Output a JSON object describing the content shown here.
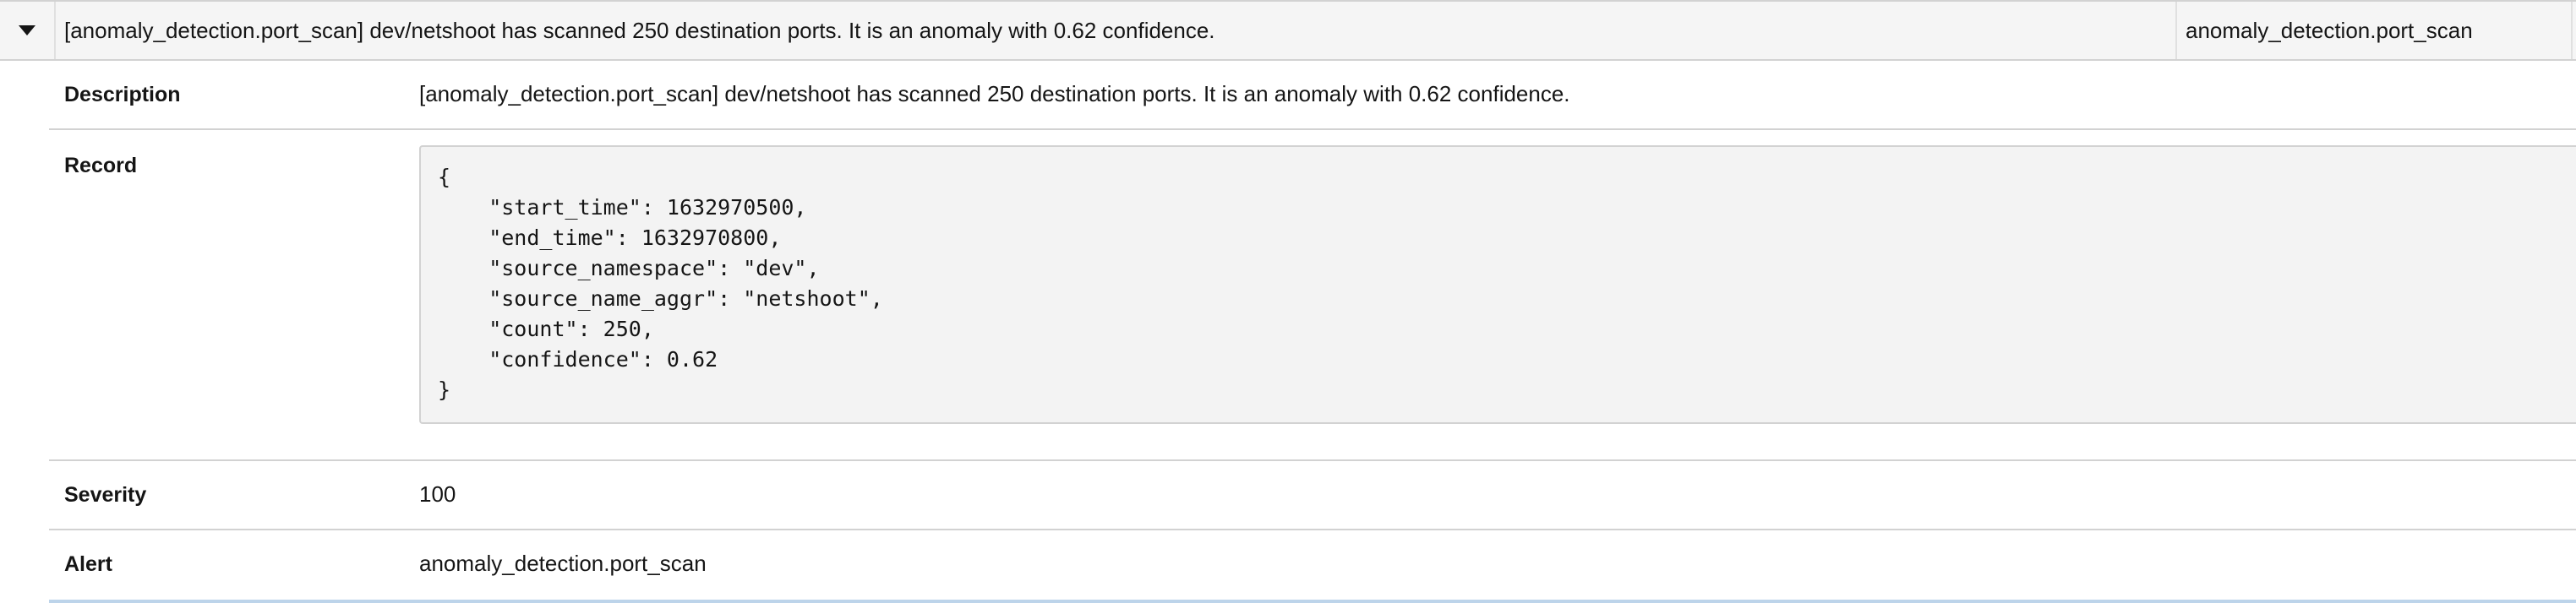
{
  "event": {
    "title": "[anomaly_detection.port_scan] dev/netshoot has scanned 250 destination ports. It is an anomaly with 0.62 confidence.",
    "name": "anomaly_detection.port_scan"
  },
  "details": {
    "description": {
      "label": "Description",
      "value": "[anomaly_detection.port_scan] dev/netshoot has scanned 250 destination ports. It is an anomaly with 0.62 confidence."
    },
    "record": {
      "label": "Record",
      "code": "{\n    \"start_time\": 1632970500,\n    \"end_time\": 1632970800,\n    \"source_namespace\": \"dev\",\n    \"source_name_aggr\": \"netshoot\",\n    \"count\": 250,\n    \"confidence\": 0.62\n}"
    },
    "severity": {
      "label": "Severity",
      "value": "100"
    },
    "alert": {
      "label": "Alert",
      "value": "anomaly_detection.port_scan"
    }
  },
  "icons": {
    "toggle": "caret-down-icon"
  }
}
